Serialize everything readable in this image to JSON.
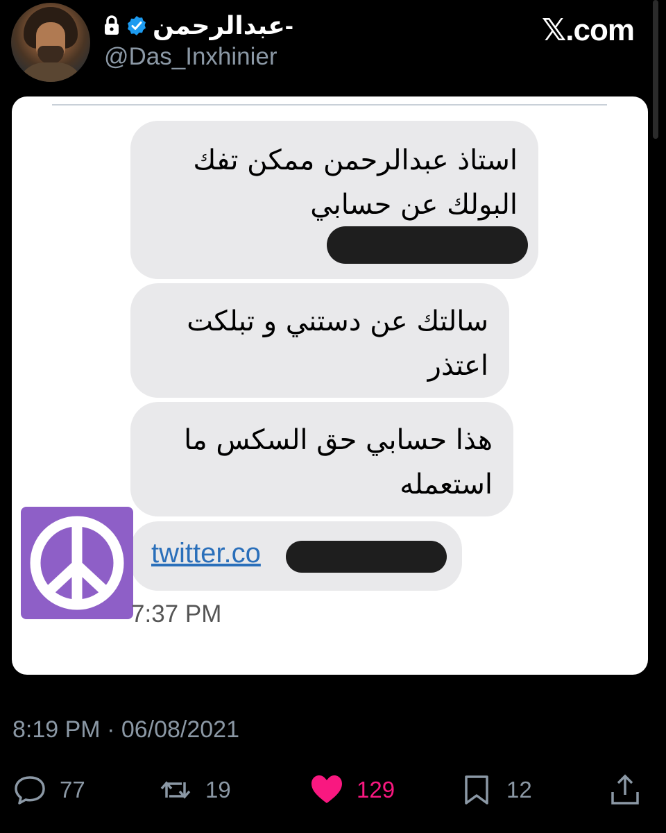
{
  "header": {
    "display_name": "عبدالرحمن-",
    "handle": "@Das_Inxhinier",
    "brand": "𝕏.com",
    "verified_icon": "verified-badge-icon",
    "lock_icon": "lock-icon",
    "verified_color": "#1d9bf0"
  },
  "card": {
    "messages": [
      {
        "lines": [
          "استاذ عبدالرحمن ممكن تفك",
          "البولك عن حسابي"
        ],
        "redacted": true
      },
      {
        "lines": [
          "سالتك عن دستني و تبلكت",
          "اعتذر"
        ]
      },
      {
        "lines": [
          "هذا حسابي حق السكس ما",
          "استعمله"
        ]
      }
    ],
    "link_text": "twitter.co",
    "link_redacted": true,
    "time": "7:37 PM",
    "avatar_icon": "peace-sign-icon",
    "avatar_color": "#8e5fc7"
  },
  "meta": {
    "timestamp": "8:19 PM · 06/08/2021"
  },
  "actions": {
    "replies": "77",
    "reposts": "19",
    "likes": "129",
    "bookmarks": "12",
    "like_color": "#f91880",
    "muted_color": "#8b98a5"
  }
}
